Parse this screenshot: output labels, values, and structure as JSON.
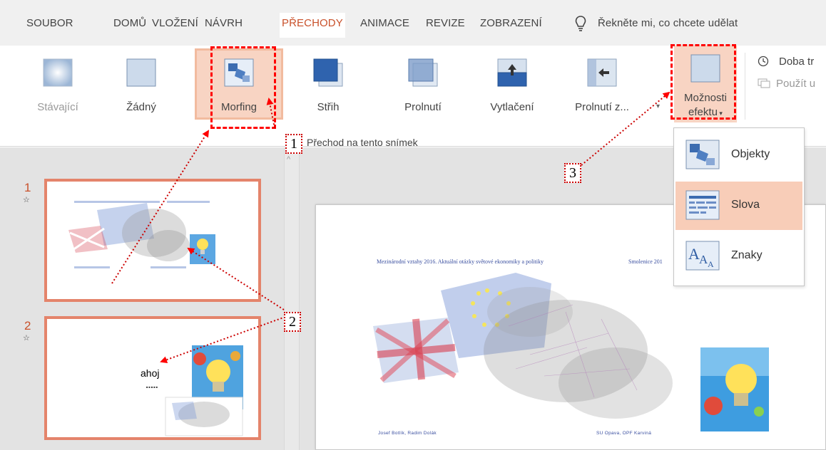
{
  "menu": {
    "tabs": [
      {
        "label": "SOUBOR"
      },
      {
        "label": "DOMŮ"
      },
      {
        "label": "VLOŽENÍ"
      },
      {
        "label": "NÁVRH"
      },
      {
        "label": "PŘECHODY"
      },
      {
        "label": "ANIMACE"
      },
      {
        "label": "REVIZE"
      },
      {
        "label": "ZOBRAZENÍ"
      }
    ],
    "tell_me": "Řekněte mi, co chcete udělat"
  },
  "ribbon": {
    "transitions": [
      {
        "label": "Stávající",
        "icon": "current-transition-icon"
      },
      {
        "label": "Žádný",
        "icon": "none-transition-icon"
      },
      {
        "label": "Morfing",
        "icon": "morph-transition-icon"
      },
      {
        "label": "Střih",
        "icon": "cut-transition-icon"
      },
      {
        "label": "Prolnutí",
        "icon": "fade-transition-icon"
      },
      {
        "label": "Vytlačení",
        "icon": "push-transition-icon"
      },
      {
        "label": "Prolnutí z...",
        "icon": "wipe-transition-icon"
      }
    ],
    "effect_options": {
      "line1": "Možnosti",
      "line2": "efektu"
    },
    "duration_label": "Doba tr",
    "apply_label": "Použít u",
    "group_label": "Přechod na tento snímek"
  },
  "dropdown": {
    "items": [
      {
        "label": "Objekty",
        "icon": "objects-icon",
        "selected": false
      },
      {
        "label": "Slova",
        "icon": "words-icon",
        "selected": true
      },
      {
        "label": "Znaky",
        "icon": "characters-icon",
        "selected": false
      }
    ]
  },
  "slides": [
    {
      "number": "1"
    },
    {
      "number": "2",
      "text": "ahoj",
      "subtext": "■■■■■"
    }
  ],
  "main_slide": {
    "title_left": "Mezinárodní vztahy 2016. Aktuální otázky světové ekonomiky a politiky",
    "title_right": "Smolenice 201",
    "footer_left": "Josef Botlík, Radim Dolák",
    "footer_right": "SU Opava, OPF Karviná"
  },
  "annotations": [
    "1",
    "2",
    "3"
  ],
  "colors": {
    "accent": "#c9512b",
    "highlight": "#f8d4c3",
    "annotation": "#ff0000"
  }
}
